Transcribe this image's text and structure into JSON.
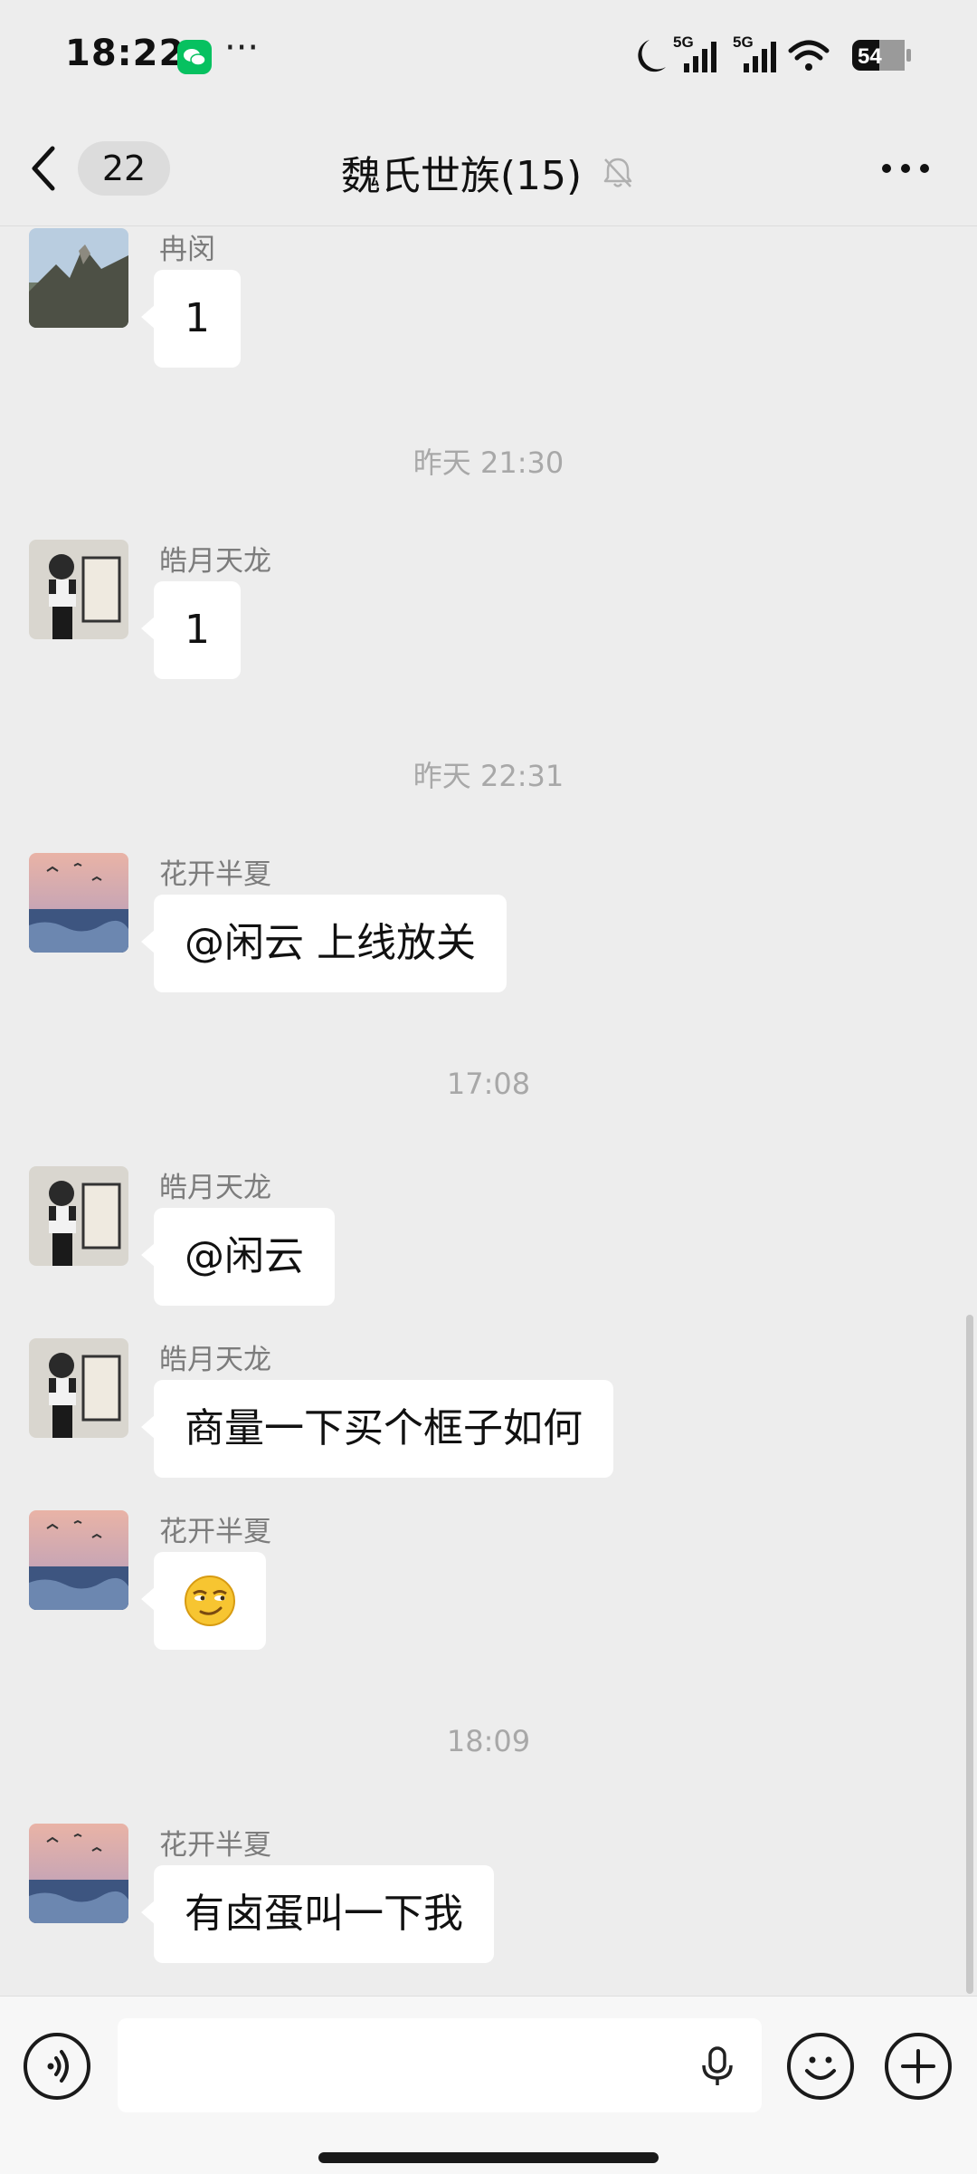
{
  "status_bar": {
    "time": "18:22",
    "more": "···",
    "battery": "54",
    "network_1": "5G",
    "network_2": "5G"
  },
  "header": {
    "unread_count": "22",
    "title": "魏氏世族(15)"
  },
  "messages": [
    {
      "type": "message",
      "sender": "冉闵",
      "text": "1",
      "avatar": "mountain-avatar"
    },
    {
      "type": "time",
      "text": "昨天 21:30"
    },
    {
      "type": "message",
      "sender": "皓月天龙",
      "text": "1",
      "avatar": "boy-avatar"
    },
    {
      "type": "time",
      "text": "昨天 22:31"
    },
    {
      "type": "message",
      "sender": "花开半夏",
      "text": "@闲云  上线放关",
      "avatar": "sunset-sea-avatar"
    },
    {
      "type": "time",
      "text": "17:08"
    },
    {
      "type": "message",
      "sender": "皓月天龙",
      "text": "@闲云",
      "avatar": "boy-avatar"
    },
    {
      "type": "message",
      "sender": "皓月天龙",
      "text": "商量一下买个框子如何",
      "avatar": "boy-avatar"
    },
    {
      "type": "message",
      "sender": "花开半夏",
      "text": "",
      "emoji": "smirk-emoji",
      "avatar": "sunset-sea-avatar"
    },
    {
      "type": "time",
      "text": "18:09"
    },
    {
      "type": "message",
      "sender": "花开半夏",
      "text": "有卤蛋叫一下我",
      "avatar": "sunset-sea-avatar"
    }
  ],
  "input": {
    "placeholder": ""
  },
  "colors": {
    "background": "#ededed",
    "bubble": "#ffffff",
    "wechat_green": "#07c160"
  }
}
